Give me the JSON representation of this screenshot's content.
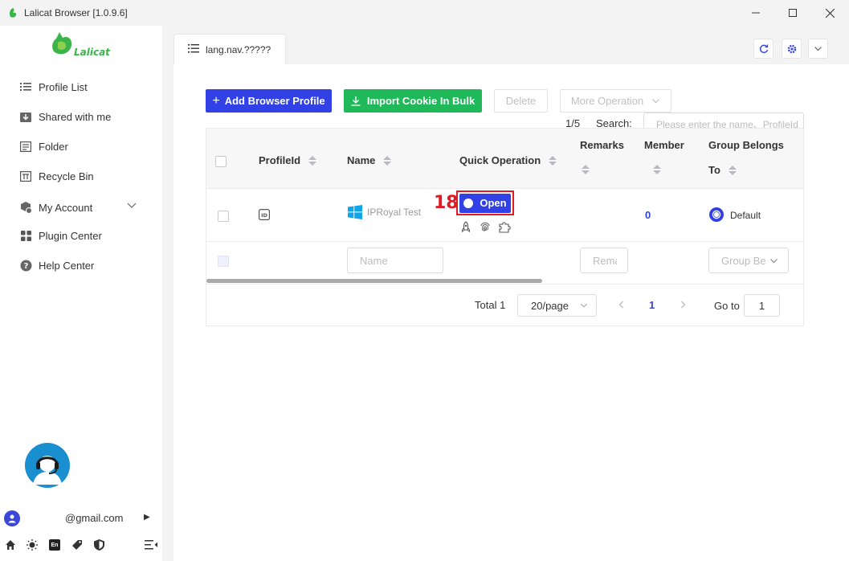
{
  "window": {
    "title": "Lalicat Browser  [1.0.9.6]",
    "minimize_icon": "minimize-icon",
    "maximize_icon": "maximize-icon",
    "close_icon": "close-icon"
  },
  "sidebar": {
    "logo_text": "Lalicat",
    "items": [
      {
        "label": "Profile List",
        "icon": "list-icon"
      },
      {
        "label": "Shared with me",
        "icon": "download-box-icon"
      },
      {
        "label": "Folder",
        "icon": "folder-icon"
      },
      {
        "label": "Recycle Bin",
        "icon": "recycle-bin-icon"
      },
      {
        "label": "My Account",
        "icon": "account-icon"
      },
      {
        "label": "Plugin Center",
        "icon": "plugin-grid-icon"
      },
      {
        "label": "Help Center",
        "icon": "help-icon"
      }
    ],
    "account_email": "@gmail.com",
    "bottom_icons": [
      "home-icon",
      "theme-sun-icon",
      "language-en-icon",
      "tag-icon",
      "shield-icon",
      "collapse-menu-icon"
    ],
    "language_badge": "En"
  },
  "tabs": [
    {
      "label": "lang.nav.?????"
    }
  ],
  "toolbar": {
    "add_profile": "Add Browser Profile",
    "import_cookie": "Import Cookie In Bulk",
    "delete": "Delete",
    "more_operation": "More Operation",
    "page_count": "1/5",
    "search_label": "Search:",
    "search_placeholder": "Please enter the name、ProfileId"
  },
  "table": {
    "headers": {
      "profile_id": "ProfileId",
      "name": "Name",
      "quick_operation": "Quick Operation",
      "remarks": "Remarks",
      "member": "Member",
      "group_line1": "Group Belongs",
      "group_line2": "To"
    },
    "rows": [
      {
        "profile_id_badge": "ID",
        "name": "IPRoyal Test",
        "open_label": "Open",
        "member": "0",
        "group": "Default"
      }
    ],
    "filters": {
      "name_placeholder": "Name",
      "remarks_placeholder": "Remarks",
      "group_placeholder": "Group Belongs To"
    }
  },
  "pagination": {
    "total": "Total 1",
    "page_size": "20/page",
    "current_page": "1",
    "goto_label": "Go to",
    "goto_value": "1"
  },
  "annotation": {
    "step_number": "18"
  },
  "colors": {
    "primary": "#3241e6",
    "green": "#1fb95a",
    "highlight": "#e01b24",
    "windows_blue": "#0ea5e9"
  }
}
